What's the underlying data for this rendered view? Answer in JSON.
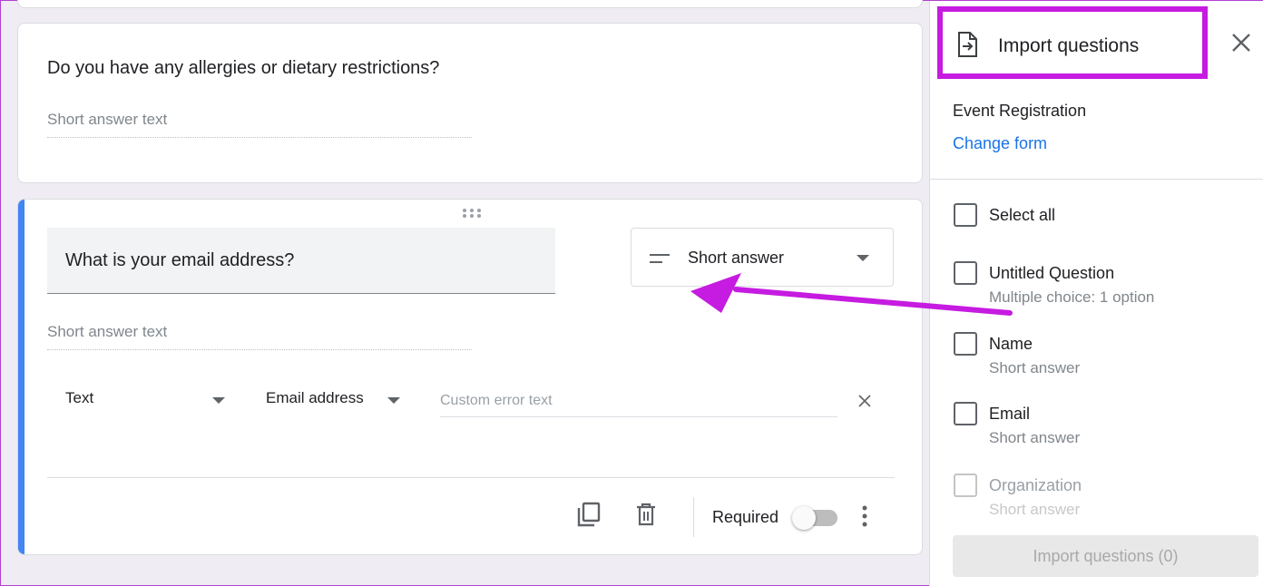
{
  "card1": {
    "question": "Do you have any allergies or dietary restrictions?",
    "answer_placeholder": "Short answer text"
  },
  "card2": {
    "question": "What is your email address?",
    "question_type": "Short answer",
    "answer_placeholder": "Short answer text",
    "validation": {
      "type": "Text",
      "condition": "Email address",
      "error_placeholder": "Custom error text"
    },
    "required_label": "Required",
    "required_on": false
  },
  "panel": {
    "title": "Import questions",
    "form_name": "Event Registration",
    "change_form": "Change form",
    "select_all": "Select all",
    "items": [
      {
        "title": "Untitled Question",
        "subtitle": "Multiple choice: 1 option"
      },
      {
        "title": "Name",
        "subtitle": "Short answer"
      },
      {
        "title": "Email",
        "subtitle": "Short answer"
      },
      {
        "title": "Organization",
        "subtitle": "Short answer"
      }
    ],
    "import_button": "Import questions (0)"
  },
  "colors": {
    "accent_blue": "#4285f4",
    "link_blue": "#1a73e8",
    "highlight_magenta": "#c61be0"
  }
}
